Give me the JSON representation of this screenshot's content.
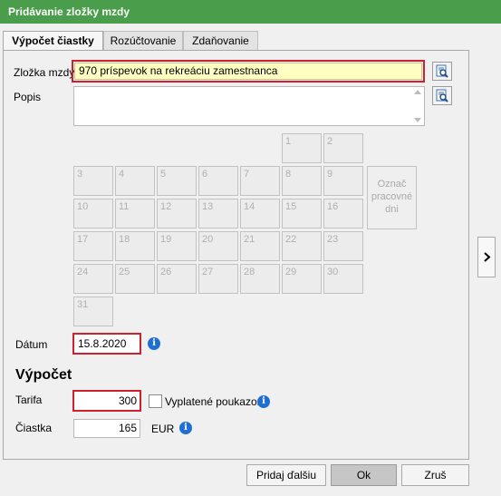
{
  "window": {
    "title": "Pridávanie zložky mzdy"
  },
  "tabs": [
    {
      "label": "Výpočet čiastky"
    },
    {
      "label": "Rozúčtovanie"
    },
    {
      "label": "Zdaňovanie"
    }
  ],
  "form": {
    "zlozka_label": "Zložka mzdy",
    "zlozka_value": "970  príspevok na rekreáciu zamestnanca",
    "popis_label": "Popis",
    "popis_value": "",
    "mark_days_label": "Označ\npracovné\ndni",
    "datum_label": "Dátum",
    "datum_value": "15.8.2020",
    "section_title": "Výpočet",
    "tarifa_label": "Tarifa",
    "tarifa_value": "300",
    "vyplatene_label": "Vyplatené poukazom",
    "vyplatene_checked": false,
    "ciastka_label": "Čiastka",
    "ciastka_value": "165",
    "currency": "EUR"
  },
  "calendar": {
    "days": [
      "1",
      "2",
      "3",
      "4",
      "5",
      "6",
      "7",
      "8",
      "9",
      "10",
      "11",
      "12",
      "13",
      "14",
      "15",
      "16",
      "17",
      "18",
      "19",
      "20",
      "21",
      "22",
      "23",
      "24",
      "25",
      "26",
      "27",
      "28",
      "29",
      "30",
      "31"
    ]
  },
  "buttons": {
    "add_next": "Pridaj ďalšiu",
    "ok": "Ok",
    "cancel": "Zruš"
  },
  "icons": {
    "lookup": "lookup-icon",
    "info": "info-icon",
    "side": "chevron-right-icon"
  }
}
